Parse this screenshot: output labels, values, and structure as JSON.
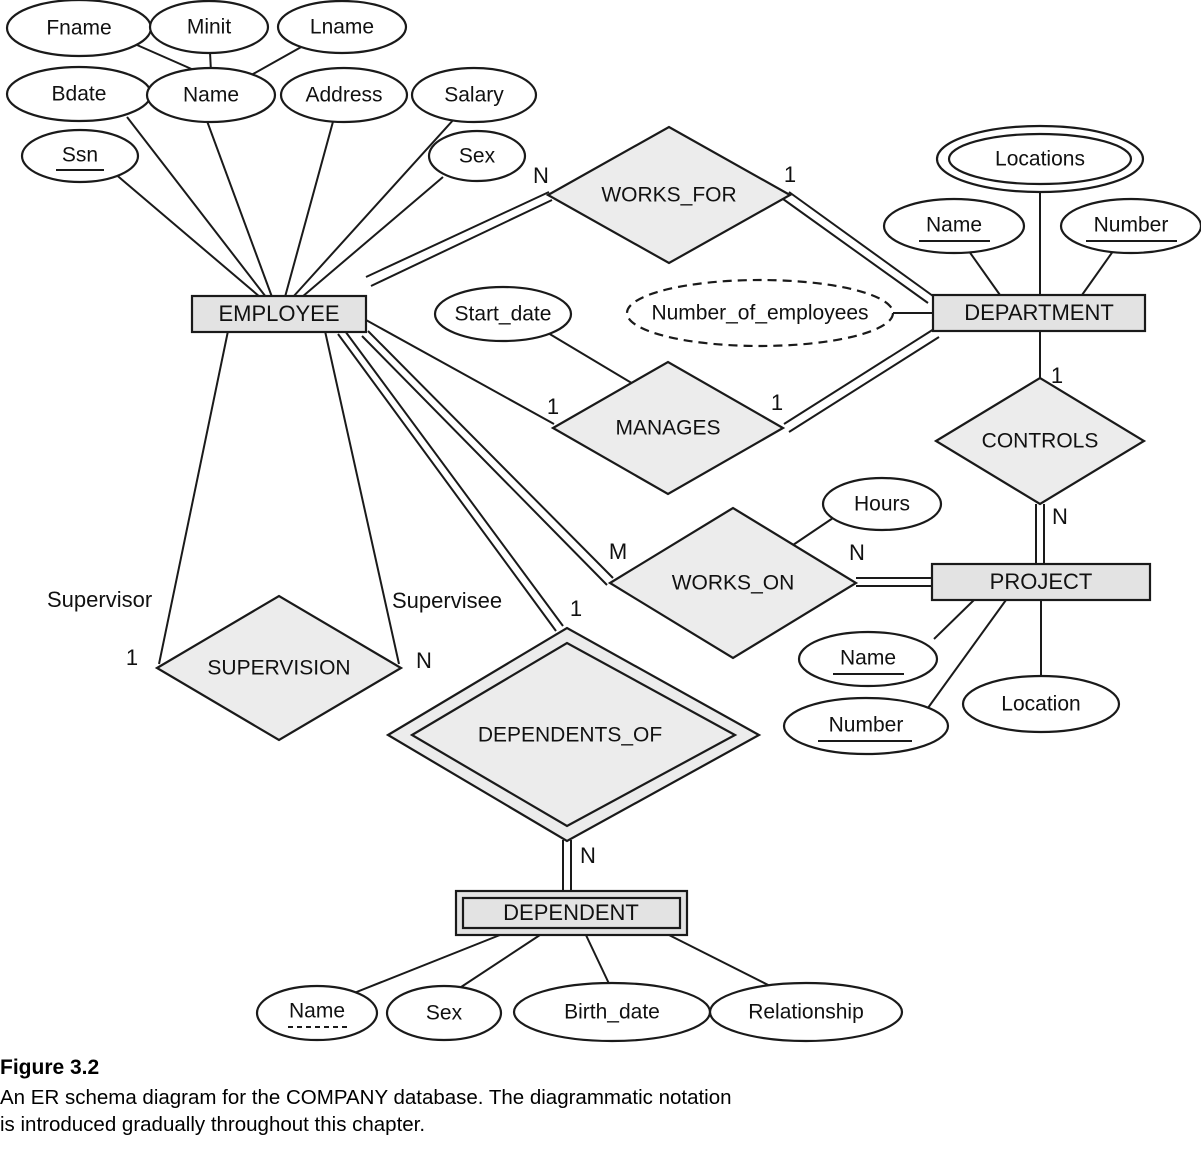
{
  "figure": {
    "title": "Figure 3.2",
    "caption_line_1": "An ER schema diagram for the COMPANY database. The diagrammatic notation",
    "caption_line_2": "is introduced gradually throughout this chapter."
  },
  "colors": {
    "entity_fill": "#e3e3e3",
    "relationship_fill": "#ececec",
    "attribute_fill": "#ffffff",
    "stroke": "#1a1a1a",
    "background": "#ffffff"
  },
  "entities": [
    {
      "id": "employee",
      "label": "EMPLOYEE",
      "weak": false
    },
    {
      "id": "department",
      "label": "DEPARTMENT",
      "weak": false
    },
    {
      "id": "project",
      "label": "PROJECT",
      "weak": false
    },
    {
      "id": "dependent",
      "label": "DEPENDENT",
      "weak": true
    }
  ],
  "relationships": [
    {
      "id": "works_for",
      "label": "WORKS_FOR",
      "identifying": false
    },
    {
      "id": "manages",
      "label": "MANAGES",
      "identifying": false
    },
    {
      "id": "works_on",
      "label": "WORKS_ON",
      "identifying": false
    },
    {
      "id": "controls",
      "label": "CONTROLS",
      "identifying": false
    },
    {
      "id": "supervision",
      "label": "SUPERVISION",
      "identifying": false
    },
    {
      "id": "dependents_of",
      "label": "DEPENDENTS_OF",
      "identifying": true
    }
  ],
  "attributes": {
    "employee": [
      {
        "id": "fname",
        "label": "Fname",
        "kind": "simple"
      },
      {
        "id": "minit",
        "label": "Minit",
        "kind": "simple"
      },
      {
        "id": "lname",
        "label": "Lname",
        "kind": "simple"
      },
      {
        "id": "bdate",
        "label": "Bdate",
        "kind": "simple"
      },
      {
        "id": "name",
        "label": "Name",
        "kind": "composite"
      },
      {
        "id": "address",
        "label": "Address",
        "kind": "simple"
      },
      {
        "id": "salary",
        "label": "Salary",
        "kind": "simple"
      },
      {
        "id": "ssn",
        "label": "Ssn",
        "kind": "key"
      },
      {
        "id": "sex",
        "label": "Sex",
        "kind": "simple"
      }
    ],
    "department": [
      {
        "id": "dept_locations",
        "label": "Locations",
        "kind": "multivalued"
      },
      {
        "id": "dept_name",
        "label": "Name",
        "kind": "key"
      },
      {
        "id": "dept_number",
        "label": "Number",
        "kind": "key"
      },
      {
        "id": "num_employees",
        "label": "Number_of_employees",
        "kind": "derived"
      }
    ],
    "project": [
      {
        "id": "proj_name",
        "label": "Name",
        "kind": "key"
      },
      {
        "id": "proj_number",
        "label": "Number",
        "kind": "key"
      },
      {
        "id": "proj_location",
        "label": "Location",
        "kind": "simple"
      }
    ],
    "dependent": [
      {
        "id": "dep_name",
        "label": "Name",
        "kind": "partial-key"
      },
      {
        "id": "dep_sex",
        "label": "Sex",
        "kind": "simple"
      },
      {
        "id": "dep_birth_date",
        "label": "Birth_date",
        "kind": "simple"
      },
      {
        "id": "dep_relationship",
        "label": "Relationship",
        "kind": "simple"
      }
    ],
    "manages": [
      {
        "id": "start_date",
        "label": "Start_date",
        "kind": "simple"
      }
    ],
    "works_on": [
      {
        "id": "hours",
        "label": "Hours",
        "kind": "simple"
      }
    ]
  },
  "cardinalities": {
    "works_for_employee": "N",
    "works_for_department": "1",
    "manages_employee": "1",
    "manages_department": "1",
    "works_on_employee": "M",
    "works_on_project": "N",
    "controls_department": "1",
    "controls_project": "N",
    "supervision_supervisor": "1",
    "supervision_supervisee": "N",
    "dependents_of_employee": "1",
    "dependents_of_dependent": "N"
  },
  "roles": {
    "supervisor": "Supervisor",
    "supervisee": "Supervisee"
  }
}
